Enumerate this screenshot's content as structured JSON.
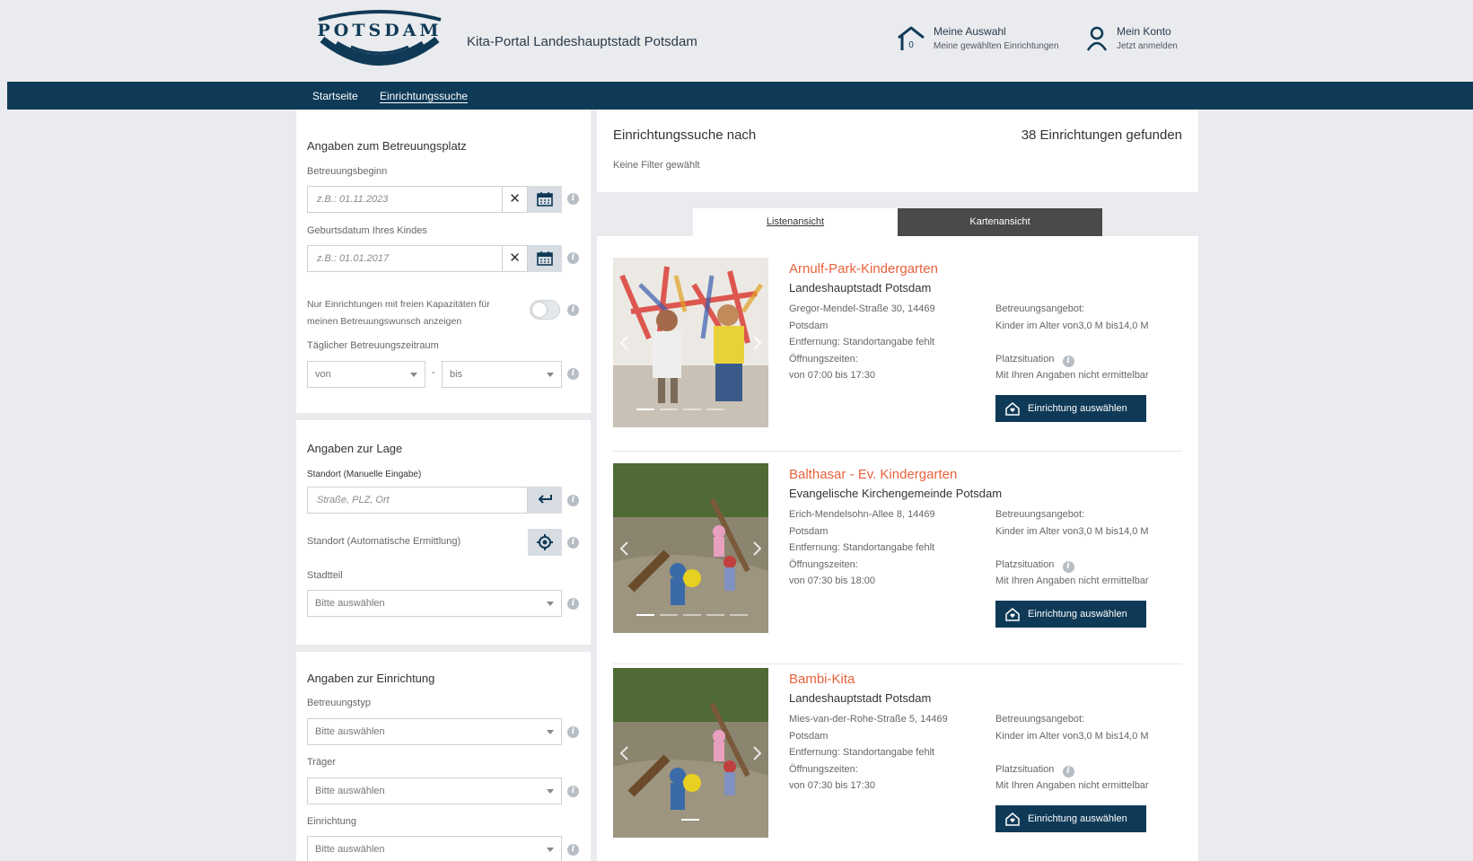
{
  "header": {
    "logo_text": "POTSDAM",
    "portal_title": "Kita-Portal Landeshauptstadt Potsdam",
    "selection": {
      "title": "Meine Auswahl",
      "subtitle": "Meine gewählten Einrichtungen",
      "count": "0"
    },
    "account": {
      "title": "Mein Konto",
      "subtitle": "Jetzt anmelden"
    }
  },
  "nav": {
    "items": [
      "Startseite",
      "Einrichtungssuche"
    ],
    "active": "Einrichtungssuche"
  },
  "sidebar": {
    "betreuung": {
      "title": "Angaben zum Betreuungsplatz",
      "begin_label": "Betreuungsbeginn",
      "begin_placeholder": "z.B.: 01.11.2023",
      "birth_label": "Geburtsdatum Ihres Kindes",
      "birth_placeholder": "z.B.: 01.01.2017",
      "capacity_text_1": "Nur Einrichtungen mit freien Kapazitäten für",
      "capacity_text_2": "meinen Betreuungswunsch anzeigen",
      "daily_label": "Täglicher Betreuungszeitraum",
      "from": "von",
      "separator": "-",
      "to": "bis"
    },
    "lage": {
      "title": "Angaben zur Lage",
      "manual_label": "Standort (Manuelle Eingabe)",
      "manual_placeholder": "Straße, PLZ, Ort",
      "auto_label": "Standort (Automatische Ermittlung)",
      "district_label": "Stadtteil",
      "district_value": "Bitte auswählen"
    },
    "einrichtung": {
      "title": "Angaben zur Einrichtung",
      "type_label": "Betreuungstyp",
      "type_value": "Bitte auswählen",
      "carrier_label": "Träger",
      "carrier_value": "Bitte auswählen",
      "facility_label": "Einrichtung",
      "facility_value": "Bitte auswählen"
    }
  },
  "main": {
    "title": "Einrichtungssuche nach",
    "count": "38 Einrichtungen gefunden",
    "filter_note": "Keine Filter gewählt",
    "tabs": [
      "Listenansicht",
      "Kartenansicht"
    ]
  },
  "results": [
    {
      "name": "Arnulf-Park-Kindergarten",
      "org": "Landeshauptstadt Potsdam",
      "address": "Gregor-Mendel-Straße 30, 14469",
      "city": "Potsdam",
      "distance": "Entfernung: Standortangabe fehlt",
      "hours_label": "Öffnungszeiten:",
      "hours": "von 07:00  bis 17:30",
      "offer_label": "Betreuungsangebot:",
      "offer": "Kinder im Alter von3,0 M  bis14,0 M",
      "platz_label": "Platzsituation",
      "platz": "Mit Ihren Angaben nicht ermittelbar",
      "button": "Einrichtung auswählen"
    },
    {
      "name": "Balthasar - Ev. Kindergarten",
      "org": "Evangelische Kirchengemeinde Potsdam",
      "address": "Erich-Mendelsohn-Allee 8, 14469",
      "city": "Potsdam",
      "distance": "Entfernung: Standortangabe fehlt",
      "hours_label": "Öffnungszeiten:",
      "hours": "von 07:30  bis 18:00",
      "offer_label": "Betreuungsangebot:",
      "offer": "Kinder im Alter von3,0 M  bis14,0 M",
      "platz_label": "Platzsituation",
      "platz": "Mit Ihren Angaben nicht ermittelbar",
      "button": "Einrichtung auswählen"
    },
    {
      "name": "Bambi-Kita",
      "org": "Landeshauptstadt Potsdam",
      "address": "Mies-van-der-Rohe-Straße 5, 14469",
      "city": "Potsdam",
      "distance": "Entfernung: Standortangabe fehlt",
      "hours_label": "Öffnungszeiten:",
      "hours": "von 07:30  bis 17:30",
      "offer_label": "Betreuungsangebot:",
      "offer": "Kinder im Alter von3,0 M  bis14,0 M",
      "platz_label": "Platzsituation",
      "platz": "Mit Ihren Angaben nicht ermittelbar",
      "button": "Einrichtung auswählen"
    }
  ]
}
